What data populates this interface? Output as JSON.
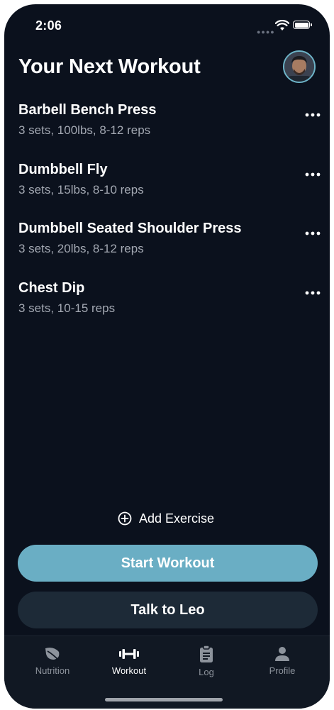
{
  "status_bar": {
    "time": "2:06"
  },
  "header": {
    "title": "Your Next Workout"
  },
  "exercises": [
    {
      "name": "Barbell Bench Press",
      "detail": "3 sets, 100lbs, 8-12 reps"
    },
    {
      "name": "Dumbbell Fly",
      "detail": "3 sets, 15lbs, 8-10 reps"
    },
    {
      "name": "Dumbbell Seated Shoulder Press",
      "detail": "3 sets, 20lbs, 8-12 reps"
    },
    {
      "name": "Chest Dip",
      "detail": "3 sets, 10-15 reps"
    }
  ],
  "actions": {
    "add_exercise": "Add Exercise",
    "start_workout": "Start Workout",
    "talk_to": "Talk to Leo"
  },
  "tab_bar": {
    "items": [
      {
        "label": "Nutrition",
        "icon": "leaf-icon"
      },
      {
        "label": "Workout",
        "icon": "dumbbell-icon"
      },
      {
        "label": "Log",
        "icon": "clipboard-icon"
      },
      {
        "label": "Profile",
        "icon": "person-icon"
      }
    ],
    "active": "Workout"
  },
  "colors": {
    "background": "#0b111d",
    "primary_button": "#6aaec4",
    "secondary_button": "#1d2a37",
    "muted_text": "#a3a8b2"
  }
}
